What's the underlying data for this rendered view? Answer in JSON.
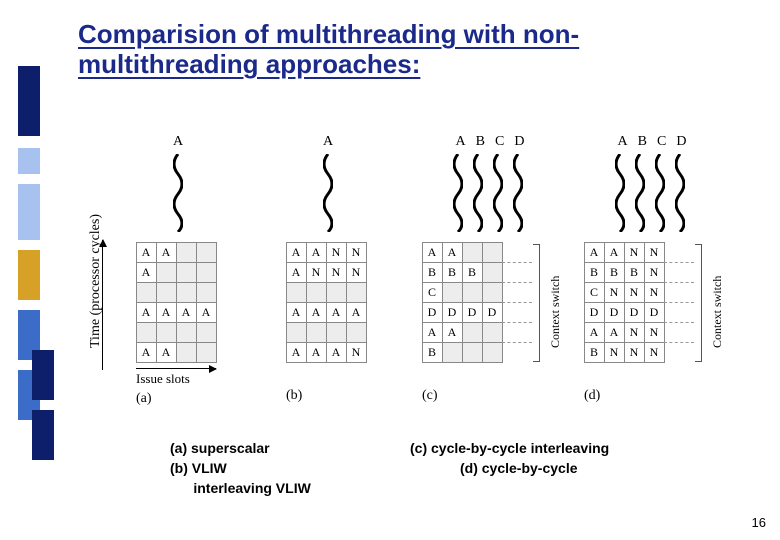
{
  "title_line1": "Comparision of multithreading with non-",
  "title_line2": "multithreading approaches:",
  "axis": {
    "y": "Time (processor cycles)",
    "x": "Issue slots"
  },
  "context_switch": "Context switch",
  "page_number": "16",
  "captions": {
    "a": "(a)",
    "b": "(b)",
    "c": "(c)",
    "d": "(d)"
  },
  "legend": {
    "a": "(a) superscalar",
    "b": "(b) VLIW",
    "c": "(c) cycle-by-cycle interleaving",
    "d_indent": "      interleaving VLIW",
    "d": "(d) cycle-by-cycle"
  },
  "chart_data": [
    {
      "id": "a",
      "type": "table",
      "threads": [
        "A"
      ],
      "rows": [
        [
          "A",
          "A",
          "",
          ""
        ],
        [
          "A",
          "",
          "",
          ""
        ],
        [
          "",
          "",
          "",
          ""
        ],
        [
          "A",
          "A",
          "A",
          "A"
        ],
        [
          "",
          "",
          "",
          ""
        ],
        [
          "A",
          "A",
          "",
          ""
        ]
      ]
    },
    {
      "id": "b",
      "type": "table",
      "threads": [
        "A"
      ],
      "rows": [
        [
          "A",
          "A",
          "N",
          "N"
        ],
        [
          "A",
          "N",
          "N",
          "N"
        ],
        [
          "",
          "",
          "",
          ""
        ],
        [
          "A",
          "A",
          "A",
          "A"
        ],
        [
          "",
          "",
          "",
          ""
        ],
        [
          "A",
          "A",
          "A",
          "N"
        ]
      ]
    },
    {
      "id": "c",
      "type": "table",
      "threads": [
        "A",
        "B",
        "C",
        "D"
      ],
      "context_switch": [
        0,
        1,
        2,
        3,
        4,
        5
      ],
      "rows": [
        [
          "A",
          "A",
          "",
          ""
        ],
        [
          "B",
          "B",
          "B",
          ""
        ],
        [
          "C",
          "",
          "",
          ""
        ],
        [
          "D",
          "D",
          "D",
          "D"
        ],
        [
          "A",
          "A",
          "",
          ""
        ],
        [
          "B",
          "",
          "",
          ""
        ]
      ]
    },
    {
      "id": "d",
      "type": "table",
      "threads": [
        "A",
        "B",
        "C",
        "D"
      ],
      "context_switch": [
        0,
        1,
        2,
        3,
        4,
        5
      ],
      "rows": [
        [
          "A",
          "A",
          "N",
          "N"
        ],
        [
          "B",
          "B",
          "B",
          "N"
        ],
        [
          "C",
          "N",
          "N",
          "N"
        ],
        [
          "D",
          "D",
          "D",
          "D"
        ],
        [
          "A",
          "A",
          "N",
          "N"
        ],
        [
          "B",
          "N",
          "N",
          "N"
        ]
      ]
    }
  ]
}
